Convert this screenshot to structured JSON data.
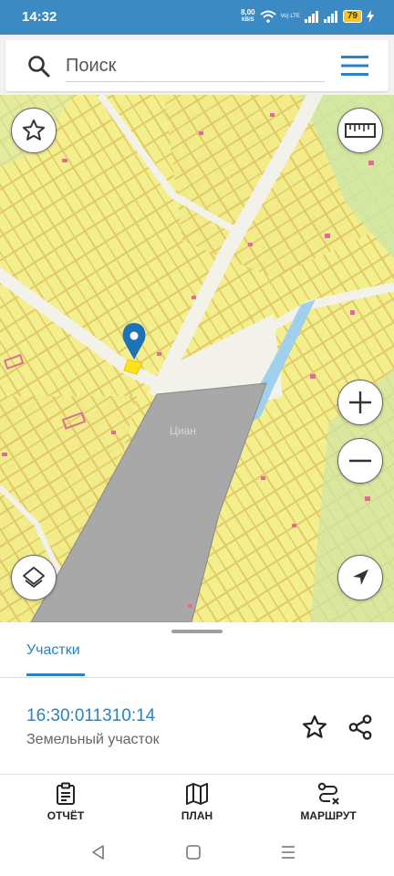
{
  "status_bar": {
    "time": "14:32",
    "net_speed_value": "8,00",
    "net_speed_unit": "КВ/S",
    "volte": "Vo) LTE",
    "battery": "79"
  },
  "search": {
    "placeholder": "Поиск",
    "value": ""
  },
  "map": {
    "watermark": "Циан",
    "colors": {
      "parcel_fill": "#f4ef8d",
      "parcel_stroke": "#e2c969",
      "road": "#f3f2ea",
      "large_plot": "#a8a8a8",
      "water": "#9fd0ee",
      "green": "#cfe6a7",
      "pin": "#1e73b8"
    },
    "icons": {
      "favorite": "star-icon",
      "ruler": "ruler-icon",
      "zoom_in": "plus-icon",
      "zoom_out": "minus-icon",
      "layers": "layers-icon",
      "locate": "navigation-arrow-icon"
    }
  },
  "sheet": {
    "tab_label": "Участки",
    "parcel_number": "16:30:011310:14",
    "parcel_type": "Земельный участок"
  },
  "bottom_nav": {
    "items": [
      {
        "label": "ОТЧЁТ",
        "icon": "clipboard-icon"
      },
      {
        "label": "ПЛАН",
        "icon": "map-icon"
      },
      {
        "label": "МАРШРУТ",
        "icon": "route-icon"
      }
    ]
  },
  "system_nav": {
    "icons": [
      "back-icon",
      "home-icon",
      "recents-icon"
    ]
  }
}
